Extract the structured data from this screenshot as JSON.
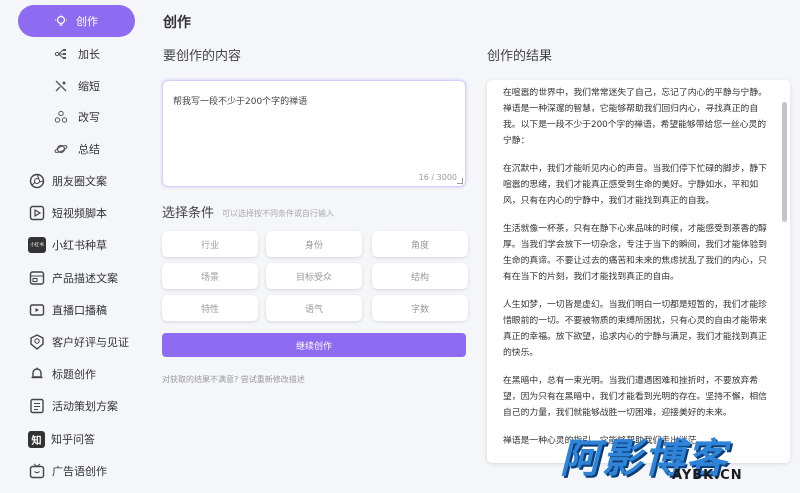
{
  "sidebar": {
    "items": [
      {
        "label": "创作",
        "icon": "bulb-icon"
      },
      {
        "label": "加长",
        "icon": "expand-icon"
      },
      {
        "label": "缩短",
        "icon": "shrink-icon"
      },
      {
        "label": "改写",
        "icon": "rewrite-icon"
      },
      {
        "label": "总结",
        "icon": "planet-icon"
      },
      {
        "label": "朋友圈文案",
        "icon": "aperture-icon"
      },
      {
        "label": "短视频脚本",
        "icon": "video-icon"
      },
      {
        "label": "小红书种草",
        "icon": "xiaohongshu-icon",
        "icon_text": "小红书"
      },
      {
        "label": "产品描述文案",
        "icon": "product-icon"
      },
      {
        "label": "直播口播稿",
        "icon": "live-icon"
      },
      {
        "label": "客户好评与见证",
        "icon": "badge-icon"
      },
      {
        "label": "标题创作",
        "icon": "bell-icon"
      },
      {
        "label": "活动策划方案",
        "icon": "plan-icon"
      },
      {
        "label": "知乎问答",
        "icon": "zhihu-icon",
        "icon_text": "知"
      },
      {
        "label": "广告语创作",
        "icon": "tv-icon"
      }
    ]
  },
  "main": {
    "title": "创作",
    "content_title": "要创作的内容",
    "input_value": "帮我写一段不少于200个字的禅语",
    "counter": "16 / 3000",
    "conditions_title": "选择条件",
    "conditions_hint": "可以选择按不同条件或自行输入",
    "chips": [
      "行业",
      "身份",
      "角度",
      "场景",
      "目标受众",
      "结构",
      "特性",
      "语气",
      "字数"
    ],
    "button_label": "继续创作",
    "retry_text": "对获取的结果不满意? 尝试重新修改描述"
  },
  "result": {
    "title": "创作的结果",
    "paragraphs": [
      "在喧嚣的世界中，我们常常迷失了自己，忘记了内心的平静与宁静。禅语是一种深邃的智慧，它能够帮助我们回归内心，寻找真正的自我。以下是一段不少于200个字的禅语，希望能够带给您一丝心灵的宁静：",
      "在沉默中，我们才能听见内心的声音。当我们停下忙碌的脚步，静下喧嚣的思绪，我们才能真正感受到生命的美好。宁静如水，平和如风，只有在内心的宁静中，我们才能找到真正的自我。",
      "生活就像一杯茶，只有在静下心来品味的时候，才能感受到茶香的醇厚。当我们学会放下一切杂念，专注于当下的瞬间，我们才能体验到生命的真谛。不要让过去的痛苦和未来的焦虑扰乱了我们的内心，只有在当下的片刻，我们才能找到真正的自由。",
      "人生如梦，一切皆是虚幻。当我们明白一切都是短暂的，我们才能珍惜眼前的一切。不要被物质的束缚所困扰，只有心灵的自由才能带来真正的幸福。放下欲望，追求内心的宁静与满足，我们才能找到真正的快乐。",
      "在黑暗中，总有一束光明。当我们遭遇困难和挫折时，不要放弃希望，因为只有在黑暗中，我们才能看到光明的存在。坚持不懈，相信自己的力量，我们就能够战胜一切困难，迎接美好的未来。",
      "禅语是一种心灵的指引，它能够帮助我们走出迷茫"
    ]
  },
  "watermark": {
    "main": "阿影博客",
    "sub": "AYBK.CN"
  },
  "colors": {
    "accent": "#8d6cf2",
    "background": "#f5f6fa",
    "watermark": "#2f84d8"
  }
}
